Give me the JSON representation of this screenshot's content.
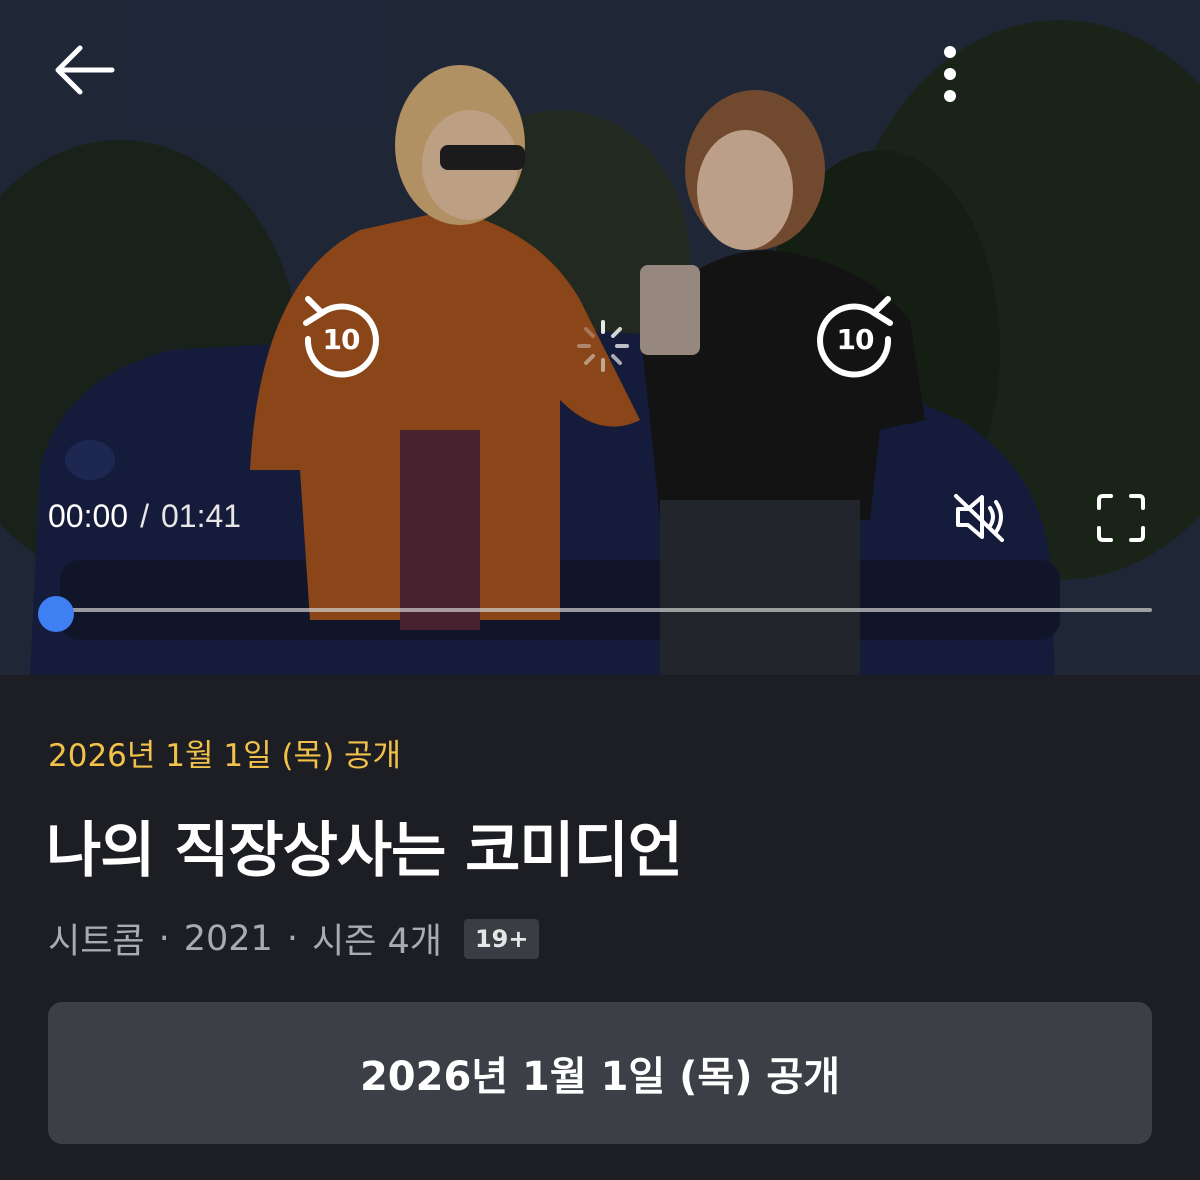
{
  "player": {
    "current_time": "00:00",
    "separator": "/",
    "duration": "01:41",
    "progress": 0,
    "skip_back_seconds": "10",
    "skip_forward_seconds": "10",
    "muted": true,
    "accent_color": "#3e7ff3"
  },
  "info": {
    "release_label": "2026년 1월 1일 (목) 공개",
    "release_color": "#f2c14a",
    "title": "나의 직장상사는 코미디언",
    "genre": "시트콤",
    "dot": "·",
    "year": "2021",
    "seasons": "시즌 4개",
    "rating_badge": "19+"
  },
  "cta": {
    "label": "2026년 1월 1일 (목) 공개"
  },
  "icons": [
    "back-arrow-icon",
    "more-vertical-icon",
    "replay-10-icon",
    "forward-10-icon",
    "loading-spinner-icon",
    "mute-icon",
    "fullscreen-icon"
  ]
}
